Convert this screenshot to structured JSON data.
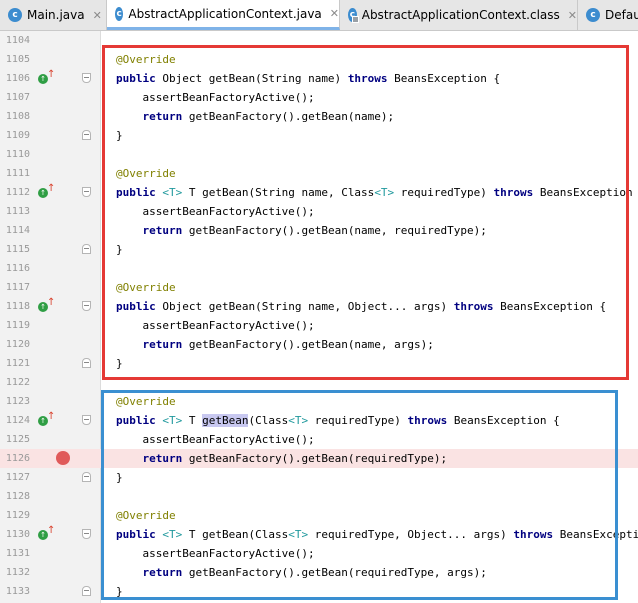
{
  "tabs": [
    {
      "label": "Main.java",
      "icon": "c",
      "close": "✕",
      "active": false
    },
    {
      "label": "AbstractApplicationContext.java",
      "icon": "c",
      "close": "✕",
      "active": true
    },
    {
      "label": "AbstractApplicationContext.class",
      "icon": "c",
      "close": "✕",
      "active": false
    },
    {
      "label": "Defau",
      "icon": "c",
      "close": "",
      "active": false
    }
  ],
  "lines": [
    {
      "num": "1104",
      "code": ""
    },
    {
      "num": "1105",
      "code": "@Override"
    },
    {
      "num": "1106",
      "code": "public Object getBean(String name) throws BeansException {"
    },
    {
      "num": "1107",
      "code": "    assertBeanFactoryActive();"
    },
    {
      "num": "1108",
      "code": "    return getBeanFactory().getBean(name);"
    },
    {
      "num": "1109",
      "code": "}"
    },
    {
      "num": "1110",
      "code": ""
    },
    {
      "num": "1111",
      "code": "@Override"
    },
    {
      "num": "1112",
      "code": "public <T> T getBean(String name, Class<T> requiredType) throws BeansException {"
    },
    {
      "num": "1113",
      "code": "    assertBeanFactoryActive();"
    },
    {
      "num": "1114",
      "code": "    return getBeanFactory().getBean(name, requiredType);"
    },
    {
      "num": "1115",
      "code": "}"
    },
    {
      "num": "1116",
      "code": ""
    },
    {
      "num": "1117",
      "code": "@Override"
    },
    {
      "num": "1118",
      "code": "public Object getBean(String name, Object... args) throws BeansException {"
    },
    {
      "num": "1119",
      "code": "    assertBeanFactoryActive();"
    },
    {
      "num": "1120",
      "code": "    return getBeanFactory().getBean(name, args);"
    },
    {
      "num": "1121",
      "code": "}"
    },
    {
      "num": "1122",
      "code": ""
    },
    {
      "num": "1123",
      "code": "@Override"
    },
    {
      "num": "1124",
      "code": "public <T> T getBean(Class<T> requiredType) throws BeansException {"
    },
    {
      "num": "1125",
      "code": "    assertBeanFactoryActive();"
    },
    {
      "num": "1126",
      "code": "    return getBeanFactory().getBean(requiredType);"
    },
    {
      "num": "1127",
      "code": "}"
    },
    {
      "num": "1128",
      "code": ""
    },
    {
      "num": "1129",
      "code": "@Override"
    },
    {
      "num": "1130",
      "code": "public <T> T getBean(Class<T> requiredType, Object... args) throws BeansException {"
    },
    {
      "num": "1131",
      "code": "    assertBeanFactoryActive();"
    },
    {
      "num": "1132",
      "code": "    return getBeanFactory().getBean(requiredType, args);"
    },
    {
      "num": "1133",
      "code": "}"
    }
  ],
  "override_markers": [
    "1106",
    "1112",
    "1118",
    "1124",
    "1130"
  ],
  "breakpoint_lines": [
    "1126"
  ],
  "highlighted_word": {
    "line": "1124",
    "text": "getBean"
  },
  "colors": {
    "red_box": "#e53935",
    "blue_box": "#3a8fd1",
    "keyword": "#000080",
    "annotation": "#808000",
    "type_param": "#20999d",
    "breakpoint": "#e05a5a"
  }
}
